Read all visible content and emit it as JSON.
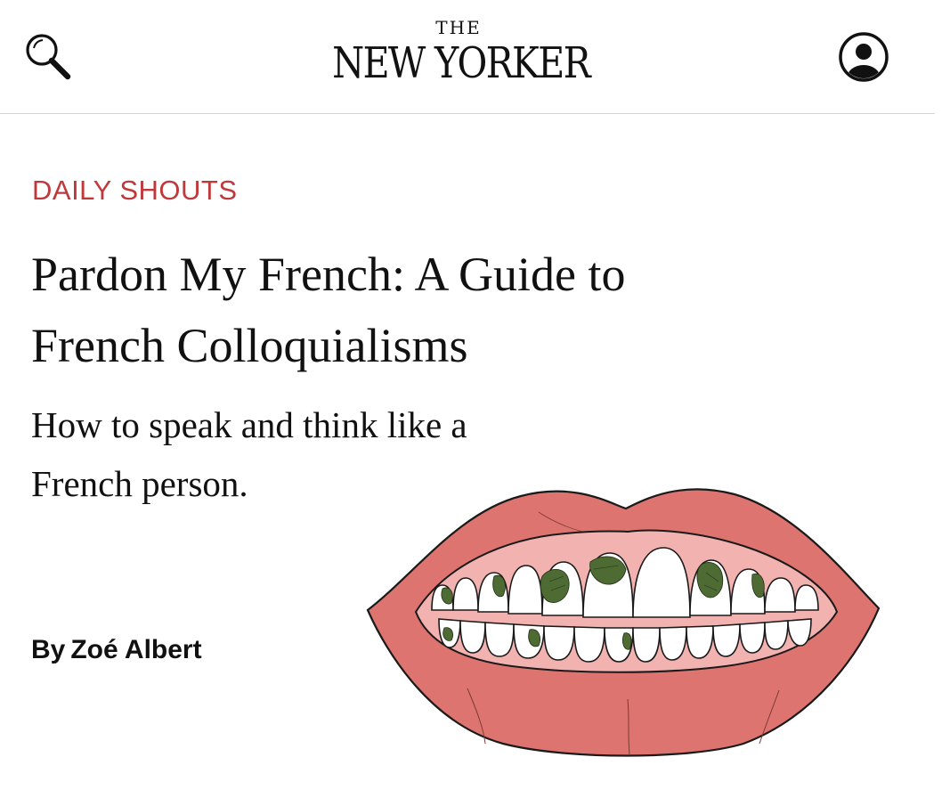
{
  "header": {
    "logo_the": "THE",
    "logo_main": "NEW YORKER",
    "search_icon": "search-icon",
    "account_icon": "user-account-icon"
  },
  "article": {
    "rubric": "DAILY SHOUTS",
    "headline_line1": "Pardon My French: A Guide to",
    "headline_line2": "French Colloquialisms",
    "dek_line1": "How to speak and think like a",
    "dek_line2": "French person.",
    "byline_prefix": "By",
    "author": "Zoé Albert"
  },
  "colors": {
    "rubric": "#c0383a",
    "lips": "#de7470",
    "gums": "#f2b3b0",
    "spinach": "#4e6b34",
    "text": "#111111"
  }
}
